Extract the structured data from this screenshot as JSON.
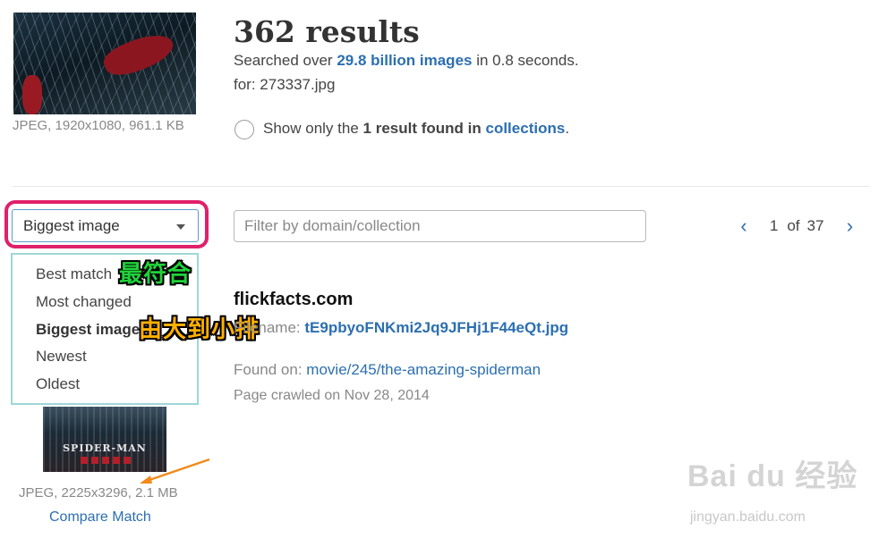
{
  "query": {
    "image_meta": "JPEG, 1920x1080, 961.1 KB"
  },
  "header": {
    "title": "362 results",
    "searched_prefix": "Searched over",
    "searched_count": "29.8 billion images",
    "searched_suffix": "in 0.8 seconds.",
    "for_line": "for: 273337.jpg",
    "collections_prefix": "Show only the",
    "collections_bold": "1 result found in",
    "collections_link": "collections",
    "collections_suffix": "."
  },
  "sort": {
    "selected": "Biggest image",
    "options": [
      "Best match",
      "Most changed",
      "Biggest image",
      "Newest",
      "Oldest"
    ]
  },
  "filter": {
    "placeholder": "Filter by domain/collection"
  },
  "pager": {
    "current": "1",
    "of_label": "of",
    "total": "37"
  },
  "annotations": {
    "best": "最符合",
    "biggest": "由大到小排"
  },
  "result": {
    "domain": "flickfacts.com",
    "filename_label": "Filename:",
    "filename": "tE9pbyoFNKmi2Jq9JFHj1F44eQt.jpg",
    "found_label": "Found on:",
    "found_link": "movie/245/the-amazing-spiderman",
    "crawled": "Page crawled on Nov 28, 2014",
    "image_meta": "JPEG, 2225x3296, 2.1 MB",
    "compare": "Compare Match",
    "thumb_title": "SPIDER-MAN"
  },
  "watermark": {
    "logo": "Bai du 经验",
    "url": "jingyan.baidu.com"
  },
  "colors": {
    "link": "#2c6fb0",
    "highlight": "#e0206a",
    "annotation_green": "#20d23a",
    "annotation_orange": "#ffb000"
  }
}
